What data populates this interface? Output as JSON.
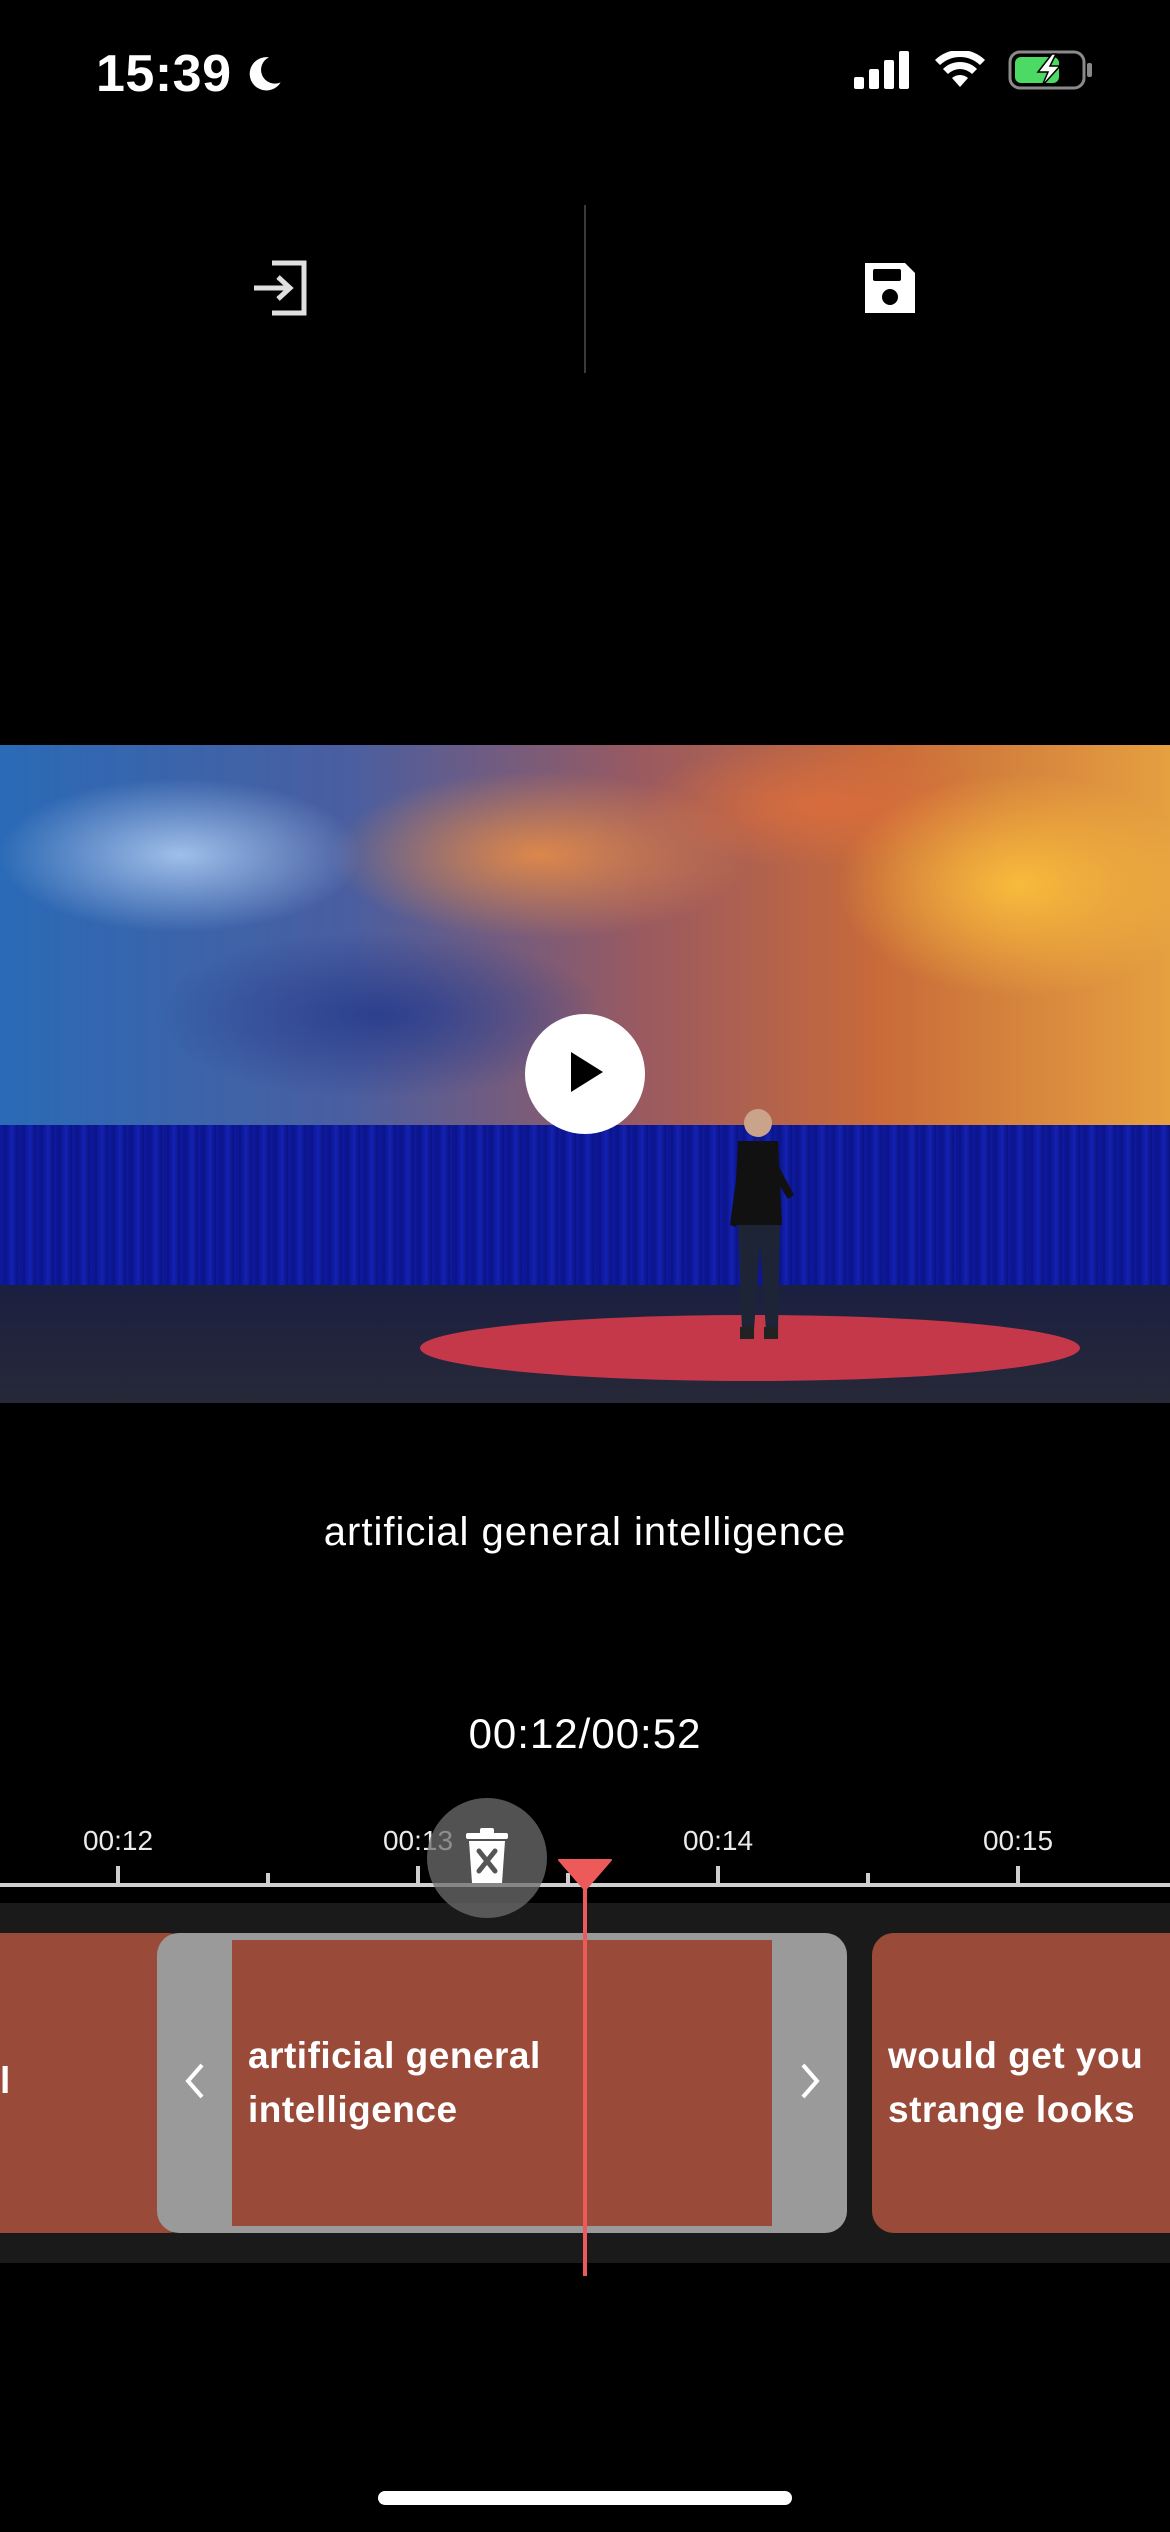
{
  "status_bar": {
    "time": "15:39",
    "focus_icon": "moon-icon",
    "signal_icon": "cellular-signal-icon",
    "wifi_icon": "wifi-icon",
    "battery_icon": "battery-charging-icon"
  },
  "toolbar": {
    "exit_icon": "exit-icon",
    "save_icon": "save-icon"
  },
  "video": {
    "play_icon": "play-icon"
  },
  "caption": {
    "text": "artificial general intelligence"
  },
  "playback": {
    "timecode": "00:12/00:52"
  },
  "ruler": {
    "labels": [
      "00:12",
      "00:13",
      "00:14",
      "00:15"
    ]
  },
  "timeline": {
    "clips": [
      {
        "text": "l"
      },
      {
        "text": "artificial general intelligence",
        "selected": true
      },
      {
        "text": "would get you strange looks"
      }
    ]
  },
  "colors": {
    "clip": "#9a4a39",
    "playhead": "#ec5a5a",
    "handle": "#9a9a9a",
    "battery_fill": "#4cd964"
  }
}
